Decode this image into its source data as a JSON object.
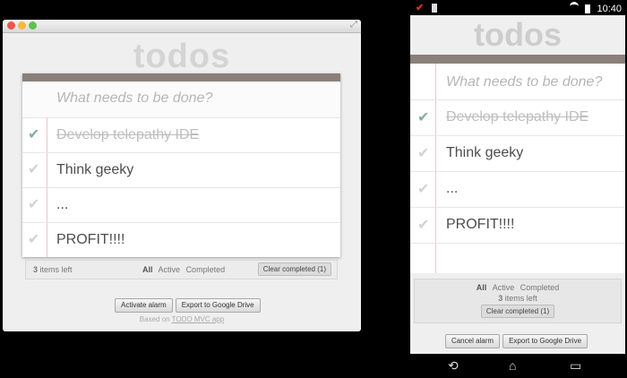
{
  "desktop": {
    "brand": "todos",
    "placeholder": "What needs to be done?",
    "todos": [
      {
        "text": "Develop telepathy IDE",
        "completed": true
      },
      {
        "text": "Think geeky",
        "completed": false
      },
      {
        "text": "...",
        "completed": false
      },
      {
        "text": "PROFIT!!!!",
        "completed": false
      }
    ],
    "footer": {
      "count": "3",
      "count_suffix": "items left",
      "filters": [
        "All",
        "Active",
        "Completed"
      ],
      "selected_filter": "All",
      "clear_label": "Clear completed (1)"
    },
    "buttons": {
      "alarm": "Activate alarm",
      "export": "Export to Google Drive"
    },
    "based_on": {
      "prefix": "Based on",
      "link": "TODO MVC app"
    }
  },
  "phone": {
    "status": {
      "time": "10:40"
    },
    "brand": "todos",
    "placeholder": "What needs to be done?",
    "todos": [
      {
        "text": "Develop telepathy IDE",
        "completed": true
      },
      {
        "text": "Think geeky",
        "completed": false
      },
      {
        "text": "...",
        "completed": false
      },
      {
        "text": "PROFIT!!!!",
        "completed": false
      }
    ],
    "footer": {
      "filters": [
        "All",
        "Active",
        "Completed"
      ],
      "selected_filter": "All",
      "count": "3",
      "count_suffix": "items left",
      "clear_label": "Clear completed (1)"
    },
    "buttons": {
      "alarm": "Cancel alarm",
      "export": "Export to Google Drive"
    }
  },
  "icons": {
    "check": "✔",
    "resize": "⤢",
    "nav_back": "⟲",
    "nav_home": "⌂",
    "nav_recent": "▭"
  },
  "colors": {
    "accent_bar": "#8a7f79",
    "done_check": "#85ada7",
    "margin_line": "#f2c5c5"
  }
}
